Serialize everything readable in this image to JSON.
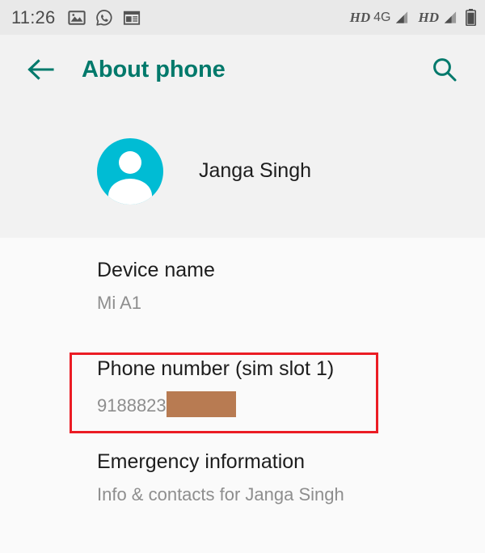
{
  "status_bar": {
    "clock": "11:26",
    "notification_icons": [
      "photos-icon",
      "whatsapp-icon",
      "news-icon"
    ],
    "hd_label_1": "HD",
    "network_label": "4G",
    "hd_label_2": "HD",
    "signal_icon": "signal-bars-icon",
    "battery_icon": "battery-icon",
    "background_color": "#E9E9E9",
    "text_color": "#4A4A4A"
  },
  "app_bar": {
    "back_icon": "arrow-left-icon",
    "title": "About phone",
    "search_icon": "search-icon",
    "accent_color": "#00796B",
    "background_color": "#F2F2F2"
  },
  "profile": {
    "avatar_icon": "person-avatar-icon",
    "avatar_color": "#00BCD4",
    "name": "Janga Singh"
  },
  "settings_list": [
    {
      "name": "device-name",
      "title": "Device name",
      "subtitle": "Mi A1",
      "highlighted": false
    },
    {
      "name": "phone-number",
      "title": "Phone number (sim slot 1)",
      "subtitle": "9188823",
      "redacted": true,
      "redaction_color": "#B87B52",
      "highlighted": true
    },
    {
      "name": "emergency-information",
      "title": "Emergency information",
      "subtitle": "Info & contacts for Janga Singh",
      "highlighted": false
    }
  ],
  "highlight": {
    "target": "phone-number",
    "color": "#EB1C24"
  },
  "colors": {
    "page_background": "#FAFAFA",
    "header_background": "#F2F2F2",
    "primary_text": "#1D1D1D",
    "secondary_text": "#8E8E8E"
  }
}
